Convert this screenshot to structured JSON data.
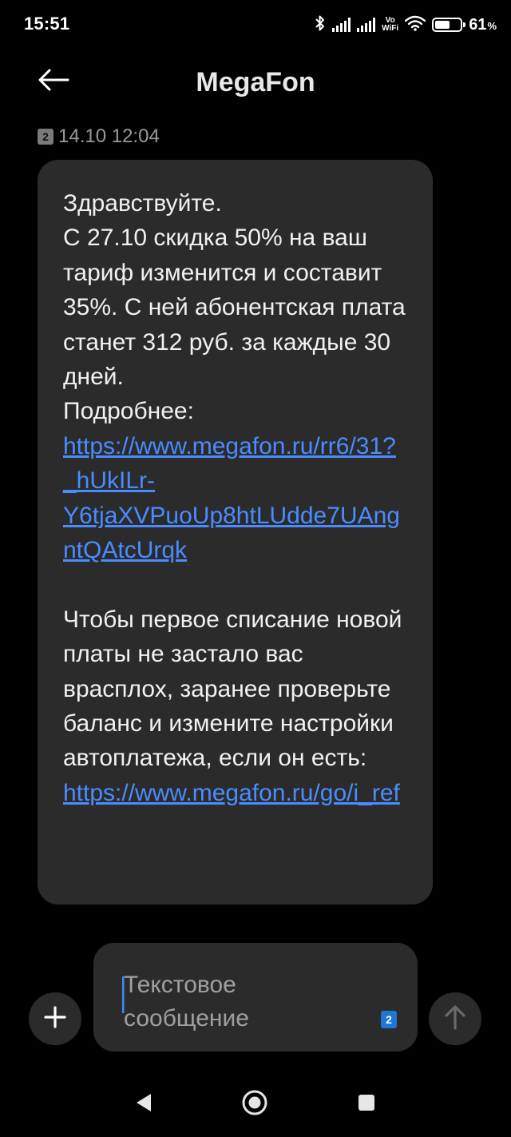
{
  "status_bar": {
    "time": "15:51",
    "vo_label": "Vo",
    "wifi_label": "WiFi",
    "battery_percent": "61",
    "battery_unit": "%",
    "battery_level": 0.61,
    "icons": [
      "bluetooth-icon",
      "signal-icon",
      "signal-icon",
      "vowifi-icon",
      "wifi-icon",
      "battery-icon"
    ]
  },
  "header": {
    "title": "MegaFon",
    "back_icon": "back-arrow-icon"
  },
  "conversation": {
    "sim_slot": "2",
    "timestamp": "14.10 12:04",
    "message": {
      "line_1": "Здравствуйте.",
      "line_2": "С 27.10 скидка 50% на ваш тариф изменится и составит 35%. С ней абонентская плата станет 312 руб. за каждые 30 дней.",
      "more_label": "Подробнее: ",
      "link_1": "https://www.megafon.ru/rr6/31?_hUkILr-Y6tjaXVPuoUp8htLUdde7UAngntQAtcUrqk",
      "paragraph_2": "Чтобы первое списание новой платы не застало вас врасплох, заранее проверьте баланс и измените настройки автоплатежа, если он есть: ",
      "link_2": "https://www.megafon.ru/go/i_ref"
    }
  },
  "composer": {
    "placeholder": "Текстовое сообщение",
    "sim_slot": "2",
    "add_icon": "plus-icon",
    "send_icon": "send-arrow-icon"
  },
  "navbar": {
    "icons": [
      "nav-back-icon",
      "nav-home-icon",
      "nav-recents-icon"
    ]
  },
  "colors": {
    "background": "#000000",
    "bubble": "#2b2b2b",
    "link": "#4a8cff",
    "sim_chip": "#1e76d6"
  }
}
